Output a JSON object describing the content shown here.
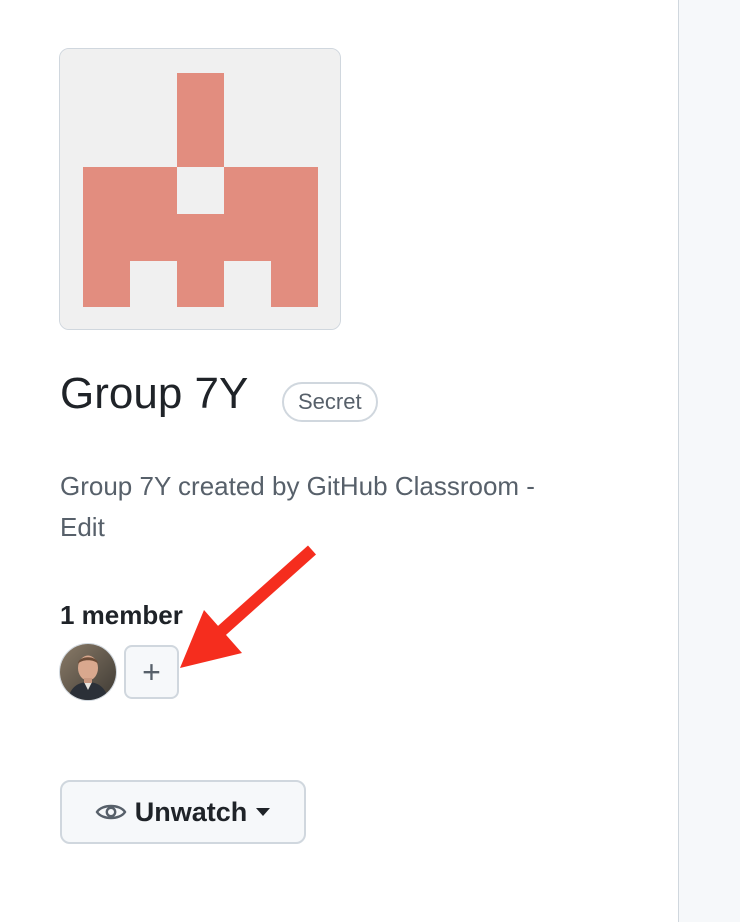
{
  "team": {
    "name": "Group 7Y",
    "visibility_badge": "Secret",
    "description": "Group 7Y created by GitHub Classroom -",
    "edit_link": "Edit"
  },
  "members": {
    "count_label": "1 member",
    "add_button_label": "+"
  },
  "watch": {
    "label": "Unwatch"
  },
  "colors": {
    "identicon": "#e28d7f",
    "identicon_bg": "#f0f0f0",
    "arrow": "#f52d1e",
    "badge_border": "#d0d7de"
  },
  "icons": {
    "team_avatar": "identicon",
    "watch": "eye-icon",
    "dropdown": "caret-down-icon",
    "add": "plus-icon",
    "annotation": "red-arrow"
  }
}
